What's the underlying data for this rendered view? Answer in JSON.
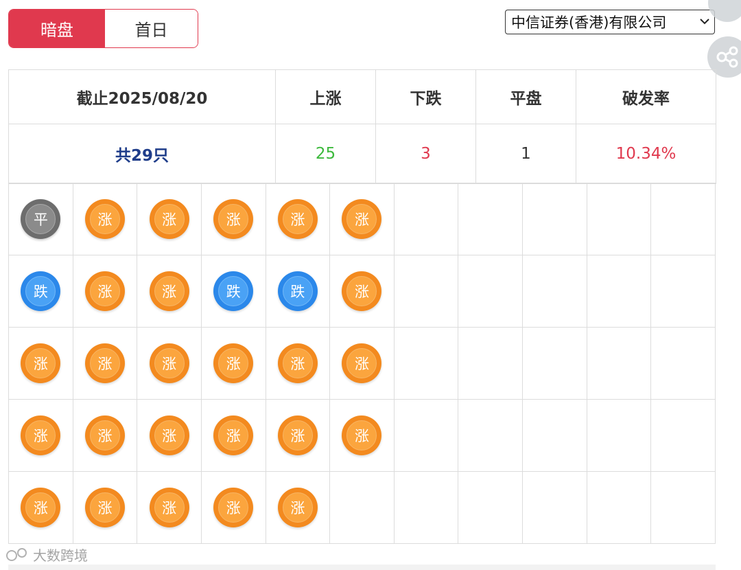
{
  "tabs": [
    {
      "label": "暗盘",
      "active": true
    },
    {
      "label": "首日",
      "active": false
    }
  ],
  "broker_select": {
    "value": "中信证券(香港)有限公司"
  },
  "summary": {
    "headers": [
      "截止2025/08/20",
      "上涨",
      "下跌",
      "平盘",
      "破发率"
    ],
    "values": {
      "total": "共29只",
      "up": "25",
      "down": "3",
      "flat": "1",
      "break_rate": "10.34%"
    }
  },
  "coin_labels": {
    "up": "涨",
    "down": "跌",
    "flat": "平"
  },
  "grid": {
    "columns": 11,
    "rows": [
      [
        "flat",
        "up",
        "up",
        "up",
        "up",
        "up"
      ],
      [
        "down",
        "up",
        "up",
        "down",
        "down",
        "up"
      ],
      [
        "up",
        "up",
        "up",
        "up",
        "up",
        "up"
      ],
      [
        "up",
        "up",
        "up",
        "up",
        "up",
        "up"
      ],
      [
        "up",
        "up",
        "up",
        "up",
        "up"
      ]
    ]
  },
  "colors": {
    "accent": "#e0394e",
    "up_text": "#3cb93c",
    "down_text": "#e0394e",
    "total_text": "#1f3d8a",
    "coin_up": "#f38a1f",
    "coin_down": "#2b88ea",
    "coin_flat": "#6d6d6d"
  },
  "watermark": {
    "text": "大数跨境"
  }
}
